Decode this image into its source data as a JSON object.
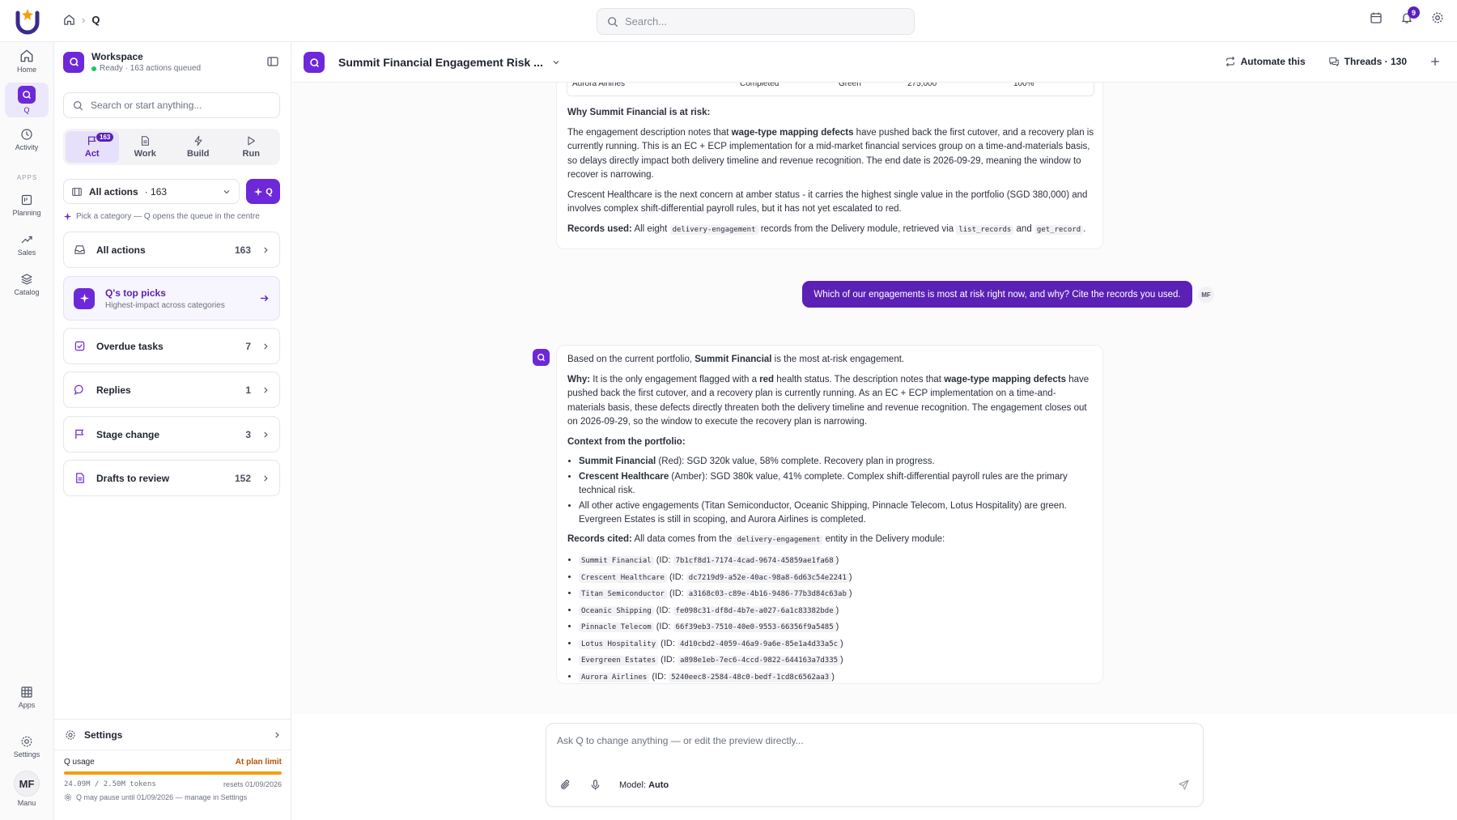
{
  "app": {
    "breadcrumb_current": "Q",
    "search_placeholder": "Search...",
    "notifications_count": "9"
  },
  "rail": {
    "items": [
      {
        "label": "Home"
      },
      {
        "label": "Q"
      },
      {
        "label": "Activity"
      },
      {
        "label": "Planning"
      },
      {
        "label": "Sales"
      },
      {
        "label": "Catalog"
      },
      {
        "label": "Apps"
      },
      {
        "label": "Settings"
      },
      {
        "label": "Manu"
      }
    ],
    "apps_heading": "APPS",
    "avatar_initials": "MF"
  },
  "sidebar": {
    "workspace_title": "Workspace",
    "workspace_status": "Ready · 163 actions queued",
    "search_placeholder": "Search or start anything...",
    "tabs": [
      {
        "label": "Act",
        "count": "163"
      },
      {
        "label": "Work"
      },
      {
        "label": "Build"
      },
      {
        "label": "Run"
      }
    ],
    "filter_label": "All actions",
    "filter_count": "· 163",
    "q_button": "Q",
    "hint": "Pick a category — Q opens the queue in the centre",
    "categories": [
      {
        "label": "All actions",
        "count": "163"
      },
      {
        "label": "Overdue tasks",
        "count": "7"
      },
      {
        "label": "Replies",
        "count": "1"
      },
      {
        "label": "Stage change",
        "count": "3"
      },
      {
        "label": "Drafts to review",
        "count": "152"
      }
    ],
    "top_picks_title": "Q's top picks",
    "top_picks_sub": "Highest-impact across categories",
    "settings_label": "Settings",
    "usage": {
      "label": "Q usage",
      "status": "At plan limit",
      "tokens": "24.09M / 2.50M tokens",
      "resets": "resets 01/09/2026",
      "note": "Q may pause until 01/09/2026 — manage in Settings",
      "fill": 1.0,
      "color": "#f59e0b"
    }
  },
  "header": {
    "title": "Summit Financial Engagement Risk ...",
    "automate": "Automate this",
    "threads": "Threads · 130"
  },
  "chat": {
    "prev_row": {
      "name": "Aurora Airlines",
      "status": "Completed",
      "health": "Green",
      "value": "275,000",
      "progress": "100%"
    },
    "prev_heading": "Why Summit Financial is at risk:",
    "prev_p1_a": "The engagement description notes that ",
    "prev_p1_b": "wage-type mapping defects",
    "prev_p1_c": " have pushed back the first cutover, and a recovery plan is currently running. This is an EC + ECP implementation for a mid-market financial services group on a time-and-materials basis, so delays directly impact both delivery timeline and revenue recognition. The end date is 2026-09-29, meaning the window to recover is narrowing.",
    "prev_p2": "Crescent Healthcare is the next concern at amber status - it carries the highest single value in the portfolio (SGD 380,000) and involves complex shift-differential payroll rules, but it has not yet escalated to red.",
    "prev_rec_label": "Records used:",
    "prev_rec_a": " All eight ",
    "prev_rec_code1": "delivery-engagement",
    "prev_rec_b": " records from the Delivery module, retrieved via ",
    "prev_rec_code2": "list_records",
    "prev_rec_c": " and ",
    "prev_rec_code3": "get_record",
    "prev_rec_d": ".",
    "user_message": "Which of our engagements is most at risk right now, and why? Cite the records you used.",
    "user_initials": "MF",
    "ans_p1_a": "Based on the current portfolio, ",
    "ans_p1_b": "Summit Financial",
    "ans_p1_c": " is the most at-risk engagement.",
    "ans_why_label": "Why:",
    "ans_why_a": " It is the only engagement flagged with a ",
    "ans_why_red": "red",
    "ans_why_b": " health status. The description notes that ",
    "ans_why_bold": "wage-type mapping defects",
    "ans_why_c": " have pushed back the first cutover, and a recovery plan is currently running. As an EC + ECP implementation on a time-and-materials basis, these defects directly threaten both the delivery timeline and revenue recognition. The engagement closes out on 2026-09-29, so the window to execute the recovery plan is narrowing.",
    "ans_context_heading": "Context from the portfolio:",
    "ans_context": [
      {
        "bold": "Summit Financial",
        "text": " (Red): SGD 320k value, 58% complete. Recovery plan in progress."
      },
      {
        "bold": "Crescent Healthcare",
        "text": " (Amber): SGD 380k value, 41% complete. Complex shift-differential payroll rules are the primary technical risk."
      },
      {
        "bold": "",
        "text": "All other active engagements (Titan Semiconductor, Oceanic Shipping, Pinnacle Telecom, Lotus Hospitality) are green. Evergreen Estates is still in scoping, and Aurora Airlines is completed."
      }
    ],
    "ans_records_label": "Records cited:",
    "ans_records_a": " All data comes from the ",
    "ans_records_code": "delivery-engagement",
    "ans_records_b": " entity in the Delivery module:",
    "records": [
      {
        "name": "Summit Financial",
        "id": "7b1cf8d1-7174-4cad-9674-45859ae1fa68"
      },
      {
        "name": "Crescent Healthcare",
        "id": "dc7219d9-a52e-40ac-98a8-6d63c54e2241"
      },
      {
        "name": "Titan Semiconductor",
        "id": "a3168c03-c89e-4b16-9486-77b3d84c63ab"
      },
      {
        "name": "Oceanic Shipping",
        "id": "fe098c31-df8d-4b7e-a027-6a1c83382bde"
      },
      {
        "name": "Pinnacle Telecom",
        "id": "66f39eb3-7510-40e0-9553-66356f9a5485"
      },
      {
        "name": "Lotus Hospitality",
        "id": "4d10cbd2-4059-46a9-9a6e-85e1a4d33a5c"
      },
      {
        "name": "Evergreen Estates",
        "id": "a898e1eb-7ec6-4ccd-9822-644163a7d335"
      },
      {
        "name": "Aurora Airlines",
        "id": "5240eec8-2584-48c0-bedf-1cd8c6562aa3"
      }
    ]
  },
  "composer": {
    "placeholder": "Ask Q to change anything — or edit the preview directly...",
    "model_label": "Model:",
    "model_value": "Auto"
  },
  "colors": {
    "accent": "#6d28d9",
    "accent_dark": "#5b21b6",
    "warning": "#b45309"
  }
}
